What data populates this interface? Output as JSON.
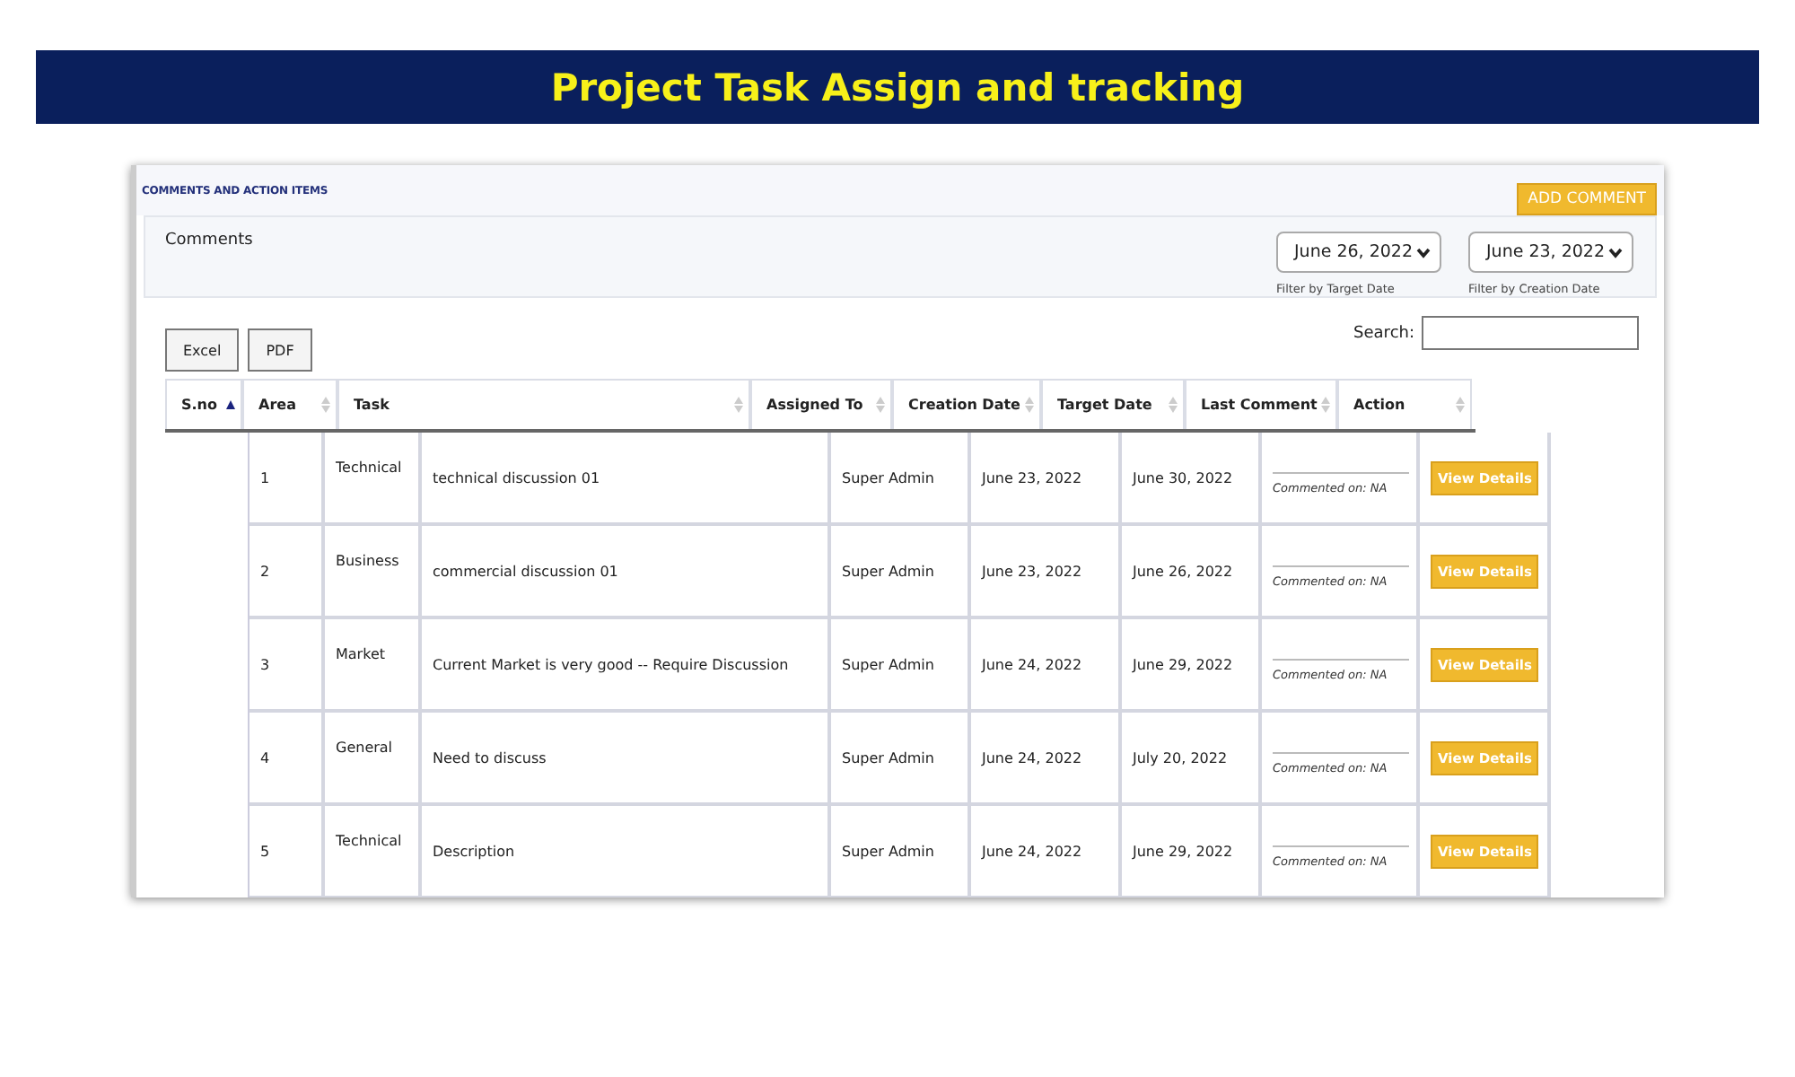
{
  "banner": {
    "title": "Project Task Assign and tracking"
  },
  "panel": {
    "title": "COMMENTS AND ACTION ITEMS",
    "add_button": "ADD COMMENT",
    "section_label": "Comments",
    "filters": [
      {
        "value": "June 26, 2022",
        "caption": "Filter by Target Date"
      },
      {
        "value": "June 23, 2022",
        "caption": "Filter by Creation Date"
      }
    ],
    "export_buttons": [
      "Excel",
      "PDF"
    ],
    "search_label": "Search:"
  },
  "table": {
    "columns": [
      {
        "label": "S.no",
        "sorted": true
      },
      {
        "label": "Area",
        "sorted": false
      },
      {
        "label": "Task",
        "sorted": false
      },
      {
        "label": "Assigned To",
        "sorted": false
      },
      {
        "label": "Creation Date",
        "sorted": false
      },
      {
        "label": "Target Date",
        "sorted": false
      },
      {
        "label": "Last Comment",
        "sorted": false
      },
      {
        "label": "Action",
        "sorted": false
      }
    ],
    "rows": [
      {
        "sno": "1",
        "area": "Technical",
        "task": "technical discussion 01",
        "assigned_to": "Super Admin",
        "creation_date": "June 23, 2022",
        "target_date": "June 30, 2022",
        "last_comment": "Commented on: NA",
        "action": "View Details"
      },
      {
        "sno": "2",
        "area": "Business",
        "task": "commercial discussion 01",
        "assigned_to": "Super Admin",
        "creation_date": "June 23, 2022",
        "target_date": "June 26, 2022",
        "last_comment": "Commented on: NA",
        "action": "View Details"
      },
      {
        "sno": "3",
        "area": "Market",
        "task": "Current Market is very good -- Require Discussion",
        "assigned_to": "Super Admin",
        "creation_date": "June 24, 2022",
        "target_date": "June 29, 2022",
        "last_comment": "Commented on: NA",
        "action": "View Details"
      },
      {
        "sno": "4",
        "area": "General",
        "task": "Need to discuss",
        "assigned_to": "Super Admin",
        "creation_date": "June 24, 2022",
        "target_date": "July 20, 2022",
        "last_comment": "Commented on: NA",
        "action": "View Details"
      },
      {
        "sno": "5",
        "area": "Technical",
        "task": "Description",
        "assigned_to": "Super Admin",
        "creation_date": "June 24, 2022",
        "target_date": "June 29, 2022",
        "last_comment": "Commented on: NA",
        "action": "View Details"
      }
    ]
  }
}
